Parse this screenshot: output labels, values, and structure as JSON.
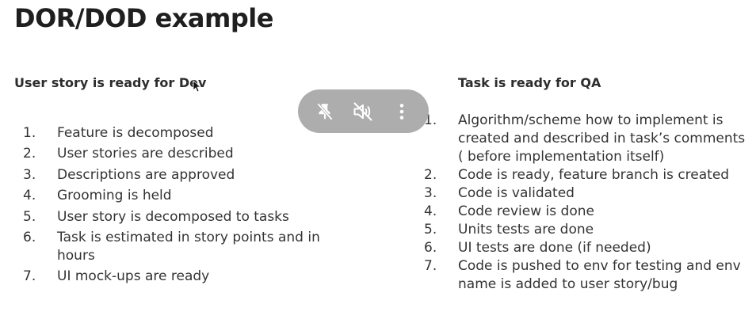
{
  "slide": {
    "title": "DOR/DOD example"
  },
  "left_column": {
    "heading": "User story is ready for Dev",
    "items": [
      {
        "number": "1.",
        "text": "Feature is decomposed"
      },
      {
        "number": "2.",
        "text": "User stories are described"
      },
      {
        "number": "3.",
        "text": "Descriptions are approved"
      },
      {
        "number": "4.",
        "text": "Grooming is held"
      },
      {
        "number": "5.",
        "text": "User story is decomposed to tasks"
      },
      {
        "number": "6.",
        "text": "Task is estimated in story points and in hours"
      },
      {
        "number": "7.",
        "text": "UI mock-ups are ready"
      }
    ]
  },
  "right_column": {
    "heading": "Task is ready for QA",
    "items": [
      {
        "number": "1.",
        "text": "Algorithm/scheme how to implement is created and described in task’s comments ( before implementation itself)"
      },
      {
        "number": "2.",
        "text": "Code is ready, feature branch is created"
      },
      {
        "number": "3.",
        "text": "Code is validated"
      },
      {
        "number": "4.",
        "text": "Code review is done"
      },
      {
        "number": "5.",
        "text": "Units tests are done"
      },
      {
        "number": "6.",
        "text": "UI tests are done (if needed)"
      },
      {
        "number": "7.",
        "text": "Code is pushed to env for testing and env name is added to user story/bug"
      }
    ]
  },
  "toolbar": {
    "buttons": [
      {
        "icon": "unpin-icon"
      },
      {
        "icon": "volume-muted-icon"
      },
      {
        "icon": "more-vert-icon"
      }
    ],
    "background": "#a9a9a9",
    "icon_color": "#ffffff"
  }
}
